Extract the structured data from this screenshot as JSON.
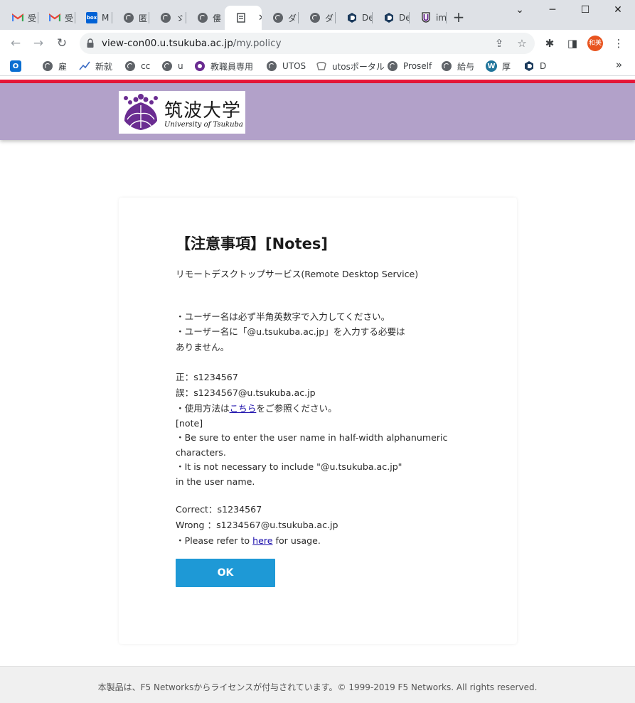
{
  "browser": {
    "tabs": [
      {
        "title": "受",
        "icon": "gmail-icon"
      },
      {
        "title": "受",
        "icon": "gmail-icon"
      },
      {
        "title": "M",
        "icon": "box-icon"
      },
      {
        "title": "匿",
        "icon": "globe-icon"
      },
      {
        "title": "ゞ",
        "icon": "globe-icon"
      },
      {
        "title": "僂",
        "icon": "globe-icon"
      },
      {
        "title": "",
        "icon": "document-icon",
        "active": true
      },
      {
        "title": "ダ",
        "icon": "globe-icon"
      },
      {
        "title": "ダ",
        "icon": "globe-icon"
      },
      {
        "title": "De",
        "icon": "hexagon-icon"
      },
      {
        "title": "De",
        "icon": "hexagon-icon"
      },
      {
        "title": "im",
        "icon": "u-shield-icon"
      }
    ],
    "url_host": "view-con00.u.tsukuba.ac.jp",
    "url_path": "/my.policy",
    "profile_initials": "和美",
    "bookmarks": [
      {
        "label": "",
        "icon": "outlook-icon"
      },
      {
        "label": "雇",
        "icon": "globe-icon"
      },
      {
        "label": "新就",
        "icon": "chart-icon"
      },
      {
        "label": "cc",
        "icon": "globe-icon"
      },
      {
        "label": "u",
        "icon": "globe-icon"
      },
      {
        "label": "教職員専用",
        "icon": "crest-icon"
      },
      {
        "label": "UTOS",
        "icon": "globe-icon"
      },
      {
        "label": "utosポータル",
        "icon": "portal-icon"
      },
      {
        "label": "Proself",
        "icon": "globe-icon"
      },
      {
        "label": "給与",
        "icon": "globe-icon"
      },
      {
        "label": "厚",
        "icon": "wordpress-icon"
      },
      {
        "label": "D",
        "icon": "hexagon-icon"
      }
    ],
    "more_bookmarks": "»"
  },
  "site": {
    "logo_jp": "筑波大学",
    "logo_en": "University of Tsukuba",
    "accent_red": "#e8173a",
    "header_purple": "#b2a1c9"
  },
  "notes": {
    "heading": "【注意事項】[Notes]",
    "service": "リモートデスクトップサービス(Remote Desktop Service)",
    "jp_line1": "・ユーザー名は必ず半角英数字で入力してください。",
    "jp_line2": "・ユーザー名に「@u.tsukuba.ac.jp」を入力する必要は",
    "jp_line3": "ありません。",
    "jp_correct": "正：s1234567",
    "jp_wrong": "誤：s1234567@u.tsukuba.ac.jp",
    "jp_usage_before": "・使用方法は",
    "jp_usage_link": "こちら",
    "jp_usage_after": "をご参照ください。",
    "en_tag": "[note]",
    "en_line1": "・Be sure to enter the user name in half-width alphanumeric",
    "en_line2": "characters.",
    "en_line3": "・It is not necessary to include \"@u.tsukuba.ac.jp\"",
    "en_line4": "in the user name.",
    "en_correct": "Correct：s1234567",
    "en_wrong": "Wrong ：s1234567@u.tsukuba.ac.jp",
    "en_usage_before": "・Please refer to ",
    "en_usage_link": "here",
    "en_usage_after": " for usage.",
    "ok_label": "OK",
    "button_color": "#1e99d6"
  },
  "footer": {
    "copyright": "本製品は、F5 Networksからライセンスが付与されています。© 1999-2019 F5 Networks. All rights reserved."
  }
}
